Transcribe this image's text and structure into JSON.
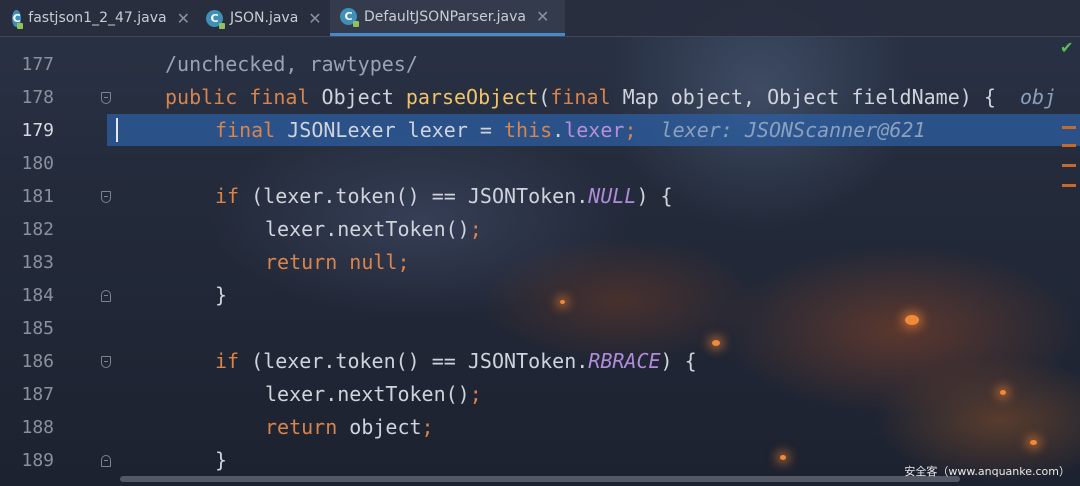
{
  "tabs": [
    {
      "label": "fastjson1_2_47.java",
      "icon": "class-c-icon",
      "active": false
    },
    {
      "label": "JSON.java",
      "icon": "class-c-icon",
      "active": false
    },
    {
      "label": "DefaultJSONParser.java",
      "icon": "class-c-icon",
      "active": true
    }
  ],
  "tab_close_glyph": "✕",
  "tab_icon_letter": "C",
  "editor": {
    "current_line": "179",
    "lines": [
      {
        "num": "177"
      },
      {
        "num": "178"
      },
      {
        "num": "179"
      },
      {
        "num": "180"
      },
      {
        "num": "181"
      },
      {
        "num": "182"
      },
      {
        "num": "183"
      },
      {
        "num": "184"
      },
      {
        "num": "185"
      },
      {
        "num": "186"
      },
      {
        "num": "187"
      },
      {
        "num": "188"
      },
      {
        "num": "189"
      }
    ],
    "code": {
      "l177": {
        "comment": "/unchecked, rawtypes/"
      },
      "l178": {
        "kw1": "public final ",
        "type1": "Object ",
        "fn": "parseObject",
        "p1": "(",
        "kw2": "final ",
        "rest": "Map object, Object fieldName) {",
        "hint": "obj"
      },
      "l179": {
        "kw1": "final ",
        "rest1": "JSONLexer lexer = ",
        "kw2": "this",
        "dot": ".",
        "field": "lexer",
        "semi": ";",
        "hint": "lexer: JSONScanner@621"
      },
      "l181": {
        "kw1": "if ",
        "rest1": "(lexer.token() == JSONToken.",
        "const": "NULL",
        "rest2": ") {"
      },
      "l182": {
        "rest": "lexer.nextToken()",
        "semi": ";"
      },
      "l183": {
        "kw1": "return null",
        "semi": ";"
      },
      "l184": {
        "rest": "}"
      },
      "l186": {
        "kw1": "if ",
        "rest1": "(lexer.token() == JSONToken.",
        "const": "RBRACE",
        "rest2": ") {"
      },
      "l187": {
        "rest": "lexer.nextToken()",
        "semi": ";"
      },
      "l188": {
        "kw1": "return ",
        "rest": "object",
        "semi": ";"
      },
      "l189": {
        "rest": "}"
      }
    }
  },
  "status_check": "✔",
  "watermark": "安全客（www.anquanke.com）",
  "colors": {
    "keyword": "#d9844a",
    "function": "#f0c36b",
    "constant": "#b08bd8",
    "highlight": "#2d5fa5",
    "active_tab_underline": "#4a88c7"
  }
}
